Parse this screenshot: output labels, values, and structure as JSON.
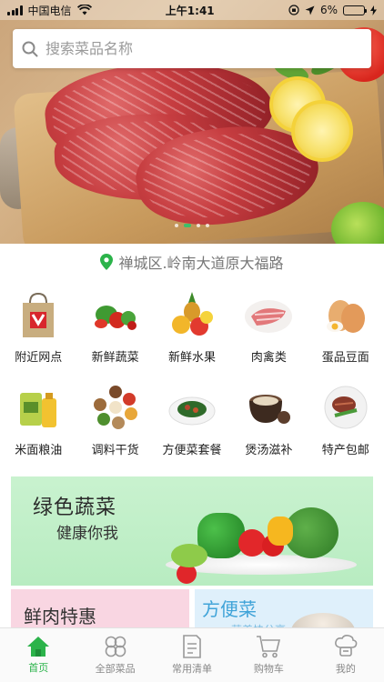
{
  "status": {
    "carrier": "中国电信",
    "time": "上午1:41",
    "battery_percent": "6%",
    "battery_level": 0.06
  },
  "search": {
    "placeholder": "搜索菜品名称"
  },
  "hero": {
    "slide_count": 4,
    "active_slide": 2
  },
  "location": {
    "text": "禅城区.岭南大道原大福路"
  },
  "categories": [
    {
      "label": "附近网点",
      "icon": "shop-bag-icon"
    },
    {
      "label": "新鲜蔬菜",
      "icon": "vegetables-icon"
    },
    {
      "label": "新鲜水果",
      "icon": "fruits-icon"
    },
    {
      "label": "肉禽类",
      "icon": "meat-icon"
    },
    {
      "label": "蛋品豆面",
      "icon": "eggs-icon"
    },
    {
      "label": "米面粮油",
      "icon": "oil-rice-icon"
    },
    {
      "label": "调料干货",
      "icon": "spices-icon"
    },
    {
      "label": "方便菜套餐",
      "icon": "dish-icon"
    },
    {
      "label": "煲汤滋补",
      "icon": "soup-pot-icon"
    },
    {
      "label": "特产包邮",
      "icon": "steak-icon"
    }
  ],
  "banner": {
    "title": "绿色蔬菜",
    "subtitle": "健康你我"
  },
  "cards": {
    "left": {
      "title": "鲜肉特惠"
    },
    "right": {
      "title": "方便菜",
      "subtitle": "营养快分享"
    }
  },
  "tabs": [
    {
      "label": "首页",
      "icon": "home-icon",
      "active": true
    },
    {
      "label": "全部菜品",
      "icon": "grid-circles-icon",
      "active": false
    },
    {
      "label": "常用清单",
      "icon": "list-doc-icon",
      "active": false
    },
    {
      "label": "购物车",
      "icon": "cart-icon",
      "active": false
    },
    {
      "label": "我的",
      "icon": "chef-hat-icon",
      "active": false
    }
  ],
  "colors": {
    "accent": "#2bb34a",
    "banner_bg": "#c9f2cf",
    "card_pink": "#f9d6e2",
    "card_blue": "#dff0fb"
  }
}
